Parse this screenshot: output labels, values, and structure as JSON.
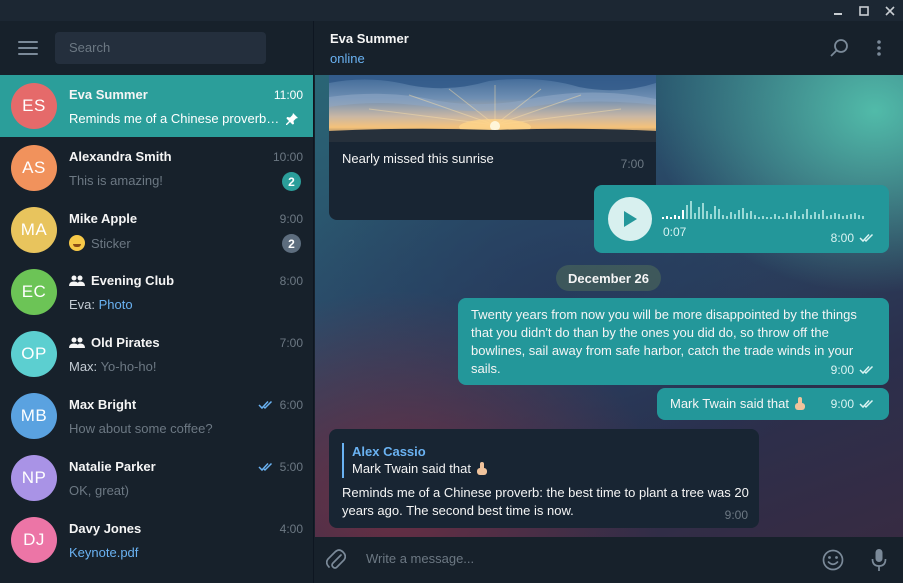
{
  "window": {
    "minimize_icon": "minimize-icon",
    "maximize_icon": "maximize-icon",
    "close_icon": "close-icon"
  },
  "sidebar": {
    "search_placeholder": "Search",
    "chats": [
      {
        "initials": "ES",
        "name": "Eva Summer",
        "time": "11:00",
        "preview": "Reminds me of a Chinese proverb: the best time to plant a tree was 20 years ago.",
        "avatar_color": "#e56a6a",
        "pinned": true,
        "active": true
      },
      {
        "initials": "AS",
        "name": "Alexandra Smith",
        "time": "10:00",
        "preview": "This is amazing!",
        "avatar_color": "#f1925c",
        "unread": "2",
        "badge_color": "#2b9e9a"
      },
      {
        "initials": "MA",
        "name": "Mike Apple",
        "time": "9:00",
        "preview": "Sticker",
        "avatar_color": "#e8c45d",
        "unread": "2",
        "badge_color": "#5d6d7e"
      },
      {
        "initials": "EC",
        "name": "Evening Club",
        "time": "8:00",
        "sender": "Eva:",
        "preview": "Photo",
        "avatar_color": "#6cc456",
        "group": true
      },
      {
        "initials": "OP",
        "name": "Old Pirates",
        "time": "7:00",
        "sender": "Max:",
        "preview": "Yo-ho-ho!",
        "avatar_color": "#5ccfd0",
        "group": true
      },
      {
        "initials": "MB",
        "name": "Max Bright",
        "time": "6:00",
        "preview": "How about some coffee?",
        "avatar_color": "#5aa2e0",
        "read": true
      },
      {
        "initials": "NP",
        "name": "Natalie Parker",
        "time": "5:00",
        "preview": "OK, great)",
        "avatar_color": "#a993e6",
        "read": true
      },
      {
        "initials": "DJ",
        "name": "Davy Jones",
        "time": "4:00",
        "preview": "Keynote.pdf",
        "avatar_color": "#ec75a6"
      }
    ]
  },
  "chat": {
    "peer_name": "Eva Summer",
    "peer_status": "online",
    "messages": {
      "photo": {
        "caption": "Nearly missed this sunrise",
        "time": "7:00"
      },
      "voice": {
        "duration": "0:07",
        "time": "8:00"
      },
      "date_separator": "December 26",
      "quote": {
        "text": "Twenty years from now you will be more disappointed by the things that you didn't do than by the ones you did do, so throw off the bowlines, sail away from safe harbor, catch the trade winds in your sails.",
        "time": "9:00"
      },
      "mark": {
        "text": "Mark Twain said that",
        "time": "9:00"
      },
      "reply": {
        "reply_author": "Alex Cassio",
        "reply_text": "Mark Twain said that",
        "text": "Reminds me of a Chinese proverb: the best time to plant a tree was 20 years ago. The second best time is now.",
        "time": "9:00"
      }
    },
    "composer_placeholder": "Write a message..."
  },
  "colors": {
    "accent": "#2b9e9a",
    "link": "#6ab2f2",
    "sidebar_bg": "#17212b",
    "outgoing_bubble": "#23979a",
    "incoming_bubble": "#182533"
  }
}
